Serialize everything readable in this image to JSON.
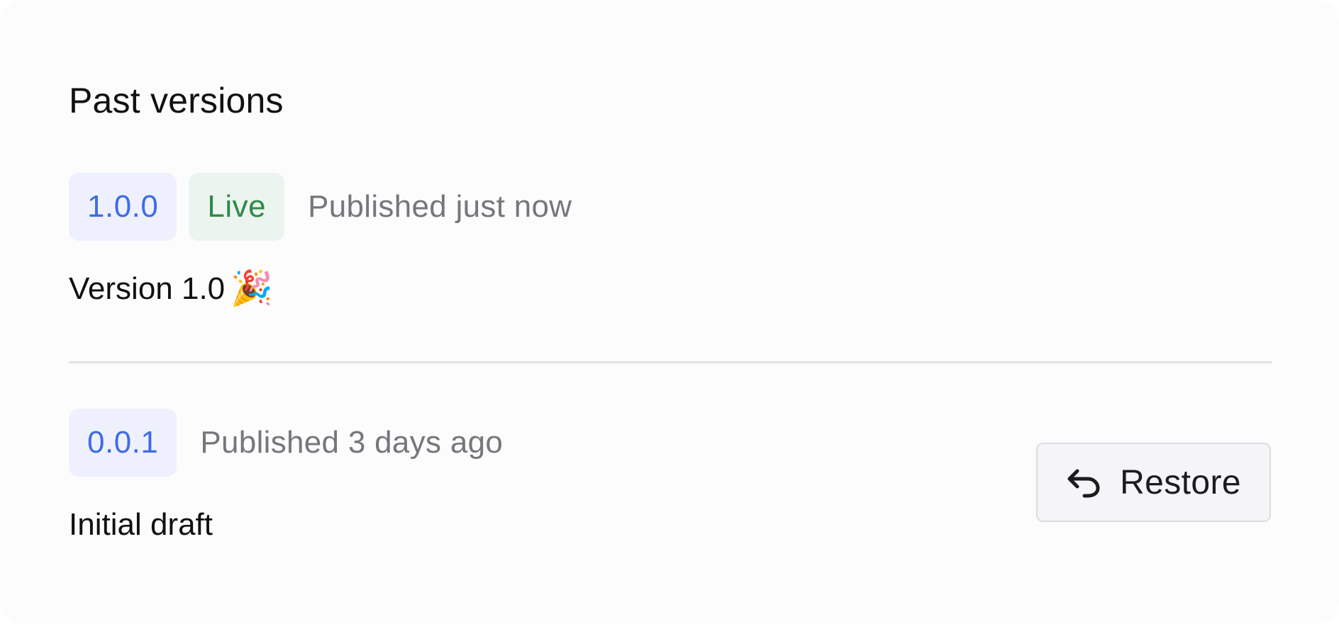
{
  "section": {
    "title": "Past versions"
  },
  "versions": [
    {
      "version": "1.0.0",
      "status": "Live",
      "published": "Published just now",
      "description": "Version 1.0",
      "description_emoji": "🎉"
    },
    {
      "version": "0.0.1",
      "published": "Published 3 days ago",
      "description": "Initial draft",
      "action_label": "Restore",
      "action_icon": "undo-arrow-icon"
    }
  ],
  "colors": {
    "version_badge_bg": "#eef0fd",
    "version_badge_text": "#3d6ce6",
    "live_badge_bg": "#ecf4ef",
    "live_badge_text": "#2f8a47",
    "muted_text": "#77767c"
  }
}
